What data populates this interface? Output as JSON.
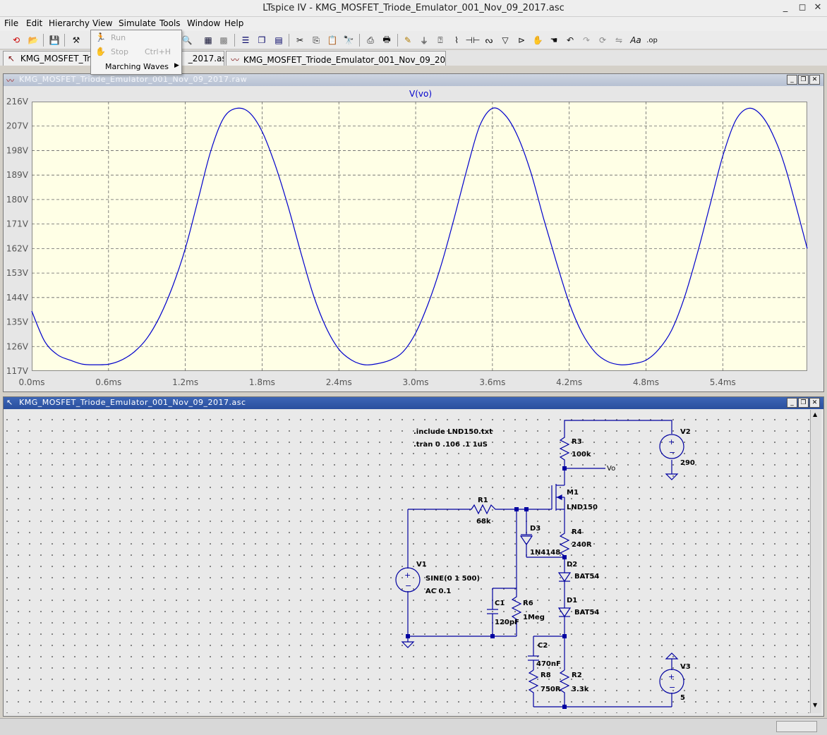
{
  "app": {
    "title": "LTspice IV - KMG_MOSFET_Triode_Emulator_001_Nov_09_2017.asc"
  },
  "menu": [
    "File",
    "Edit",
    "Hierarchy",
    "View",
    "Simulate",
    "Tools",
    "Window",
    "Help"
  ],
  "simulate_menu": {
    "run": "Run",
    "stop": "Stop",
    "stop_shortcut": "Ctrl+H",
    "marching_waves": "Marching Waves"
  },
  "tabs": [
    {
      "label": "KMG_MOSFET_Triode_Emulator_001_Nov_09_2017.asc",
      "shown": "KMG_MOSFET_Trio",
      "tail": "_2017.asc"
    },
    {
      "label": "KMG_MOSFET_Triode_Emulator_001_Nov_09_2017.raw"
    }
  ],
  "waveform": {
    "window_title": "KMG_MOSFET_Triode_Emulator_001_Nov_09_2017.raw",
    "trace_label": "V(vo)",
    "trace_color": "#0000cc"
  },
  "chart_data": {
    "type": "line",
    "title": "V(vo)",
    "xlabel": "",
    "ylabel": "",
    "xlim": [
      0.0,
      6.06
    ],
    "ylim": [
      117,
      216
    ],
    "x_ticks": [
      "0.0ms",
      "0.6ms",
      "1.2ms",
      "1.8ms",
      "2.4ms",
      "3.0ms",
      "3.6ms",
      "4.2ms",
      "4.8ms",
      "5.4ms"
    ],
    "y_ticks": [
      "117V",
      "126V",
      "135V",
      "144V",
      "153V",
      "162V",
      "171V",
      "180V",
      "189V",
      "198V",
      "207V",
      "216V"
    ],
    "grid": true,
    "series": [
      {
        "name": "V(vo)",
        "x": [
          0.0,
          0.1,
          0.2,
          0.3,
          0.4,
          0.5,
          0.6,
          0.7,
          0.8,
          0.9,
          1.0,
          1.1,
          1.2,
          1.3,
          1.4,
          1.5,
          1.6,
          1.7,
          1.8,
          1.9,
          2.0,
          2.1,
          2.2,
          2.3,
          2.4,
          2.5,
          2.6,
          2.7,
          2.8,
          2.9,
          3.0,
          3.1,
          3.2,
          3.3,
          3.4,
          3.5,
          3.6,
          3.7,
          3.8,
          3.9,
          4.0,
          4.1,
          4.2,
          4.3,
          4.4,
          4.5,
          4.6,
          4.7,
          4.8,
          4.9,
          5.0,
          5.1,
          5.2,
          5.3,
          5.4,
          5.5,
          5.6,
          5.7,
          5.8,
          5.9,
          6.06
        ],
        "values": [
          139,
          128,
          123,
          121,
          119.5,
          119.3,
          119.5,
          121,
          124,
          129,
          137,
          148,
          162,
          180,
          198,
          210,
          213.5,
          212,
          205,
          193,
          178,
          161,
          145,
          133,
          125,
          121,
          119.3,
          119.7,
          121,
          124,
          131,
          142,
          156,
          173,
          191,
          207,
          213.5,
          211,
          203,
          190,
          173,
          157,
          142,
          131,
          124,
          120.5,
          119.3,
          119.7,
          121,
          125,
          132,
          144,
          160,
          178,
          196,
          209,
          213.5,
          211,
          203,
          190,
          162
        ]
      }
    ]
  },
  "schematic": {
    "window_title": "KMG_MOSFET_Triode_Emulator_001_Nov_09_2017.asc",
    "directives": [
      ".include LND150.txt",
      ".tran 0 .106 .1 1uS"
    ],
    "components": {
      "R3": {
        "name": "R3",
        "value": "100k"
      },
      "V2": {
        "name": "V2",
        "value": "290"
      },
      "net_vo": "Vo",
      "M1": {
        "name": "M1",
        "value": "LND150"
      },
      "R1": {
        "name": "R1",
        "value": "68k"
      },
      "D3": {
        "name": "D3",
        "value": "1N4148"
      },
      "R4": {
        "name": "R4",
        "value": "240R"
      },
      "V1": {
        "name": "V1",
        "value": "SINE(0 1 500)",
        "ac": "AC 0.1"
      },
      "D2": {
        "name": "D2",
        "value": "BAT54"
      },
      "C1": {
        "name": "C1",
        "value": "120pF"
      },
      "R6": {
        "name": "R6",
        "value": "1Meg"
      },
      "D1": {
        "name": "D1",
        "value": "BAT54"
      },
      "C2": {
        "name": "C2",
        "value": "470nF"
      },
      "R8": {
        "name": "R8",
        "value": "750R"
      },
      "R2": {
        "name": "R2",
        "value": "3.3k"
      },
      "V3": {
        "name": "V3",
        "value": "5"
      }
    }
  }
}
